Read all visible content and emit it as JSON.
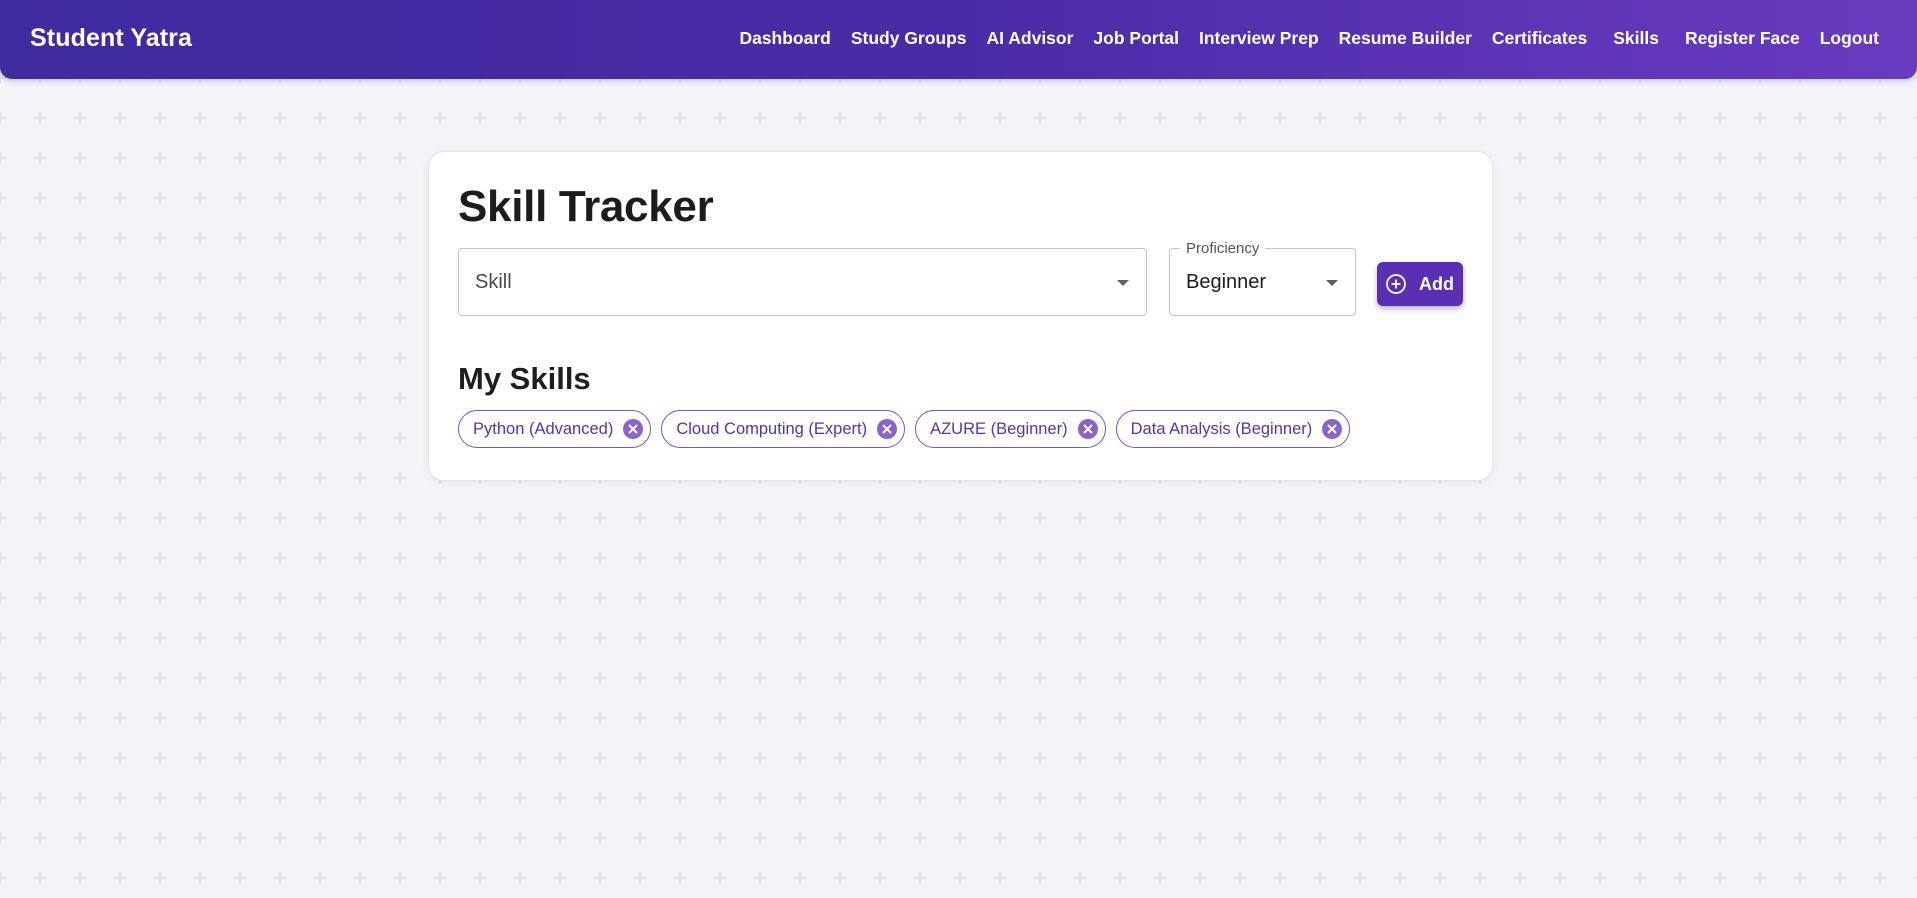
{
  "app": {
    "brand": "Student Yatra"
  },
  "nav": {
    "items": [
      {
        "label": "Dashboard"
      },
      {
        "label": "Study Groups"
      },
      {
        "label": "AI Advisor"
      },
      {
        "label": "Job Portal"
      },
      {
        "label": "Interview Prep"
      },
      {
        "label": "Resume Builder"
      },
      {
        "label": "Certificates"
      },
      {
        "label": "Skills"
      },
      {
        "label": "Register Face"
      },
      {
        "label": "Logout"
      }
    ]
  },
  "tracker": {
    "title": "Skill Tracker",
    "skill_field": {
      "placeholder": "Skill",
      "icon": "chevron-down-icon"
    },
    "proficiency_field": {
      "label": "Proficiency",
      "value": "Beginner",
      "icon": "chevron-down-icon"
    },
    "add_button": {
      "label": "Add",
      "icon": "add-circle-icon"
    }
  },
  "my_skills": {
    "title": "My Skills",
    "chips": [
      {
        "label": "Python (Advanced)"
      },
      {
        "label": "Cloud Computing (Expert)"
      },
      {
        "label": "AZURE (Beginner)"
      },
      {
        "label": "Data Analysis (Beginner)"
      }
    ],
    "delete_icon": "cancel-circle-icon"
  },
  "colors": {
    "nav_gradient_start": "#3f2a9e",
    "nav_gradient_end": "#6a3bbf",
    "accent": "#5b2fb3",
    "chip_border": "#7c52c4",
    "chip_text": "#5a33a8",
    "chip_delete": "#8a63cc",
    "background": "#f3f4f7"
  }
}
